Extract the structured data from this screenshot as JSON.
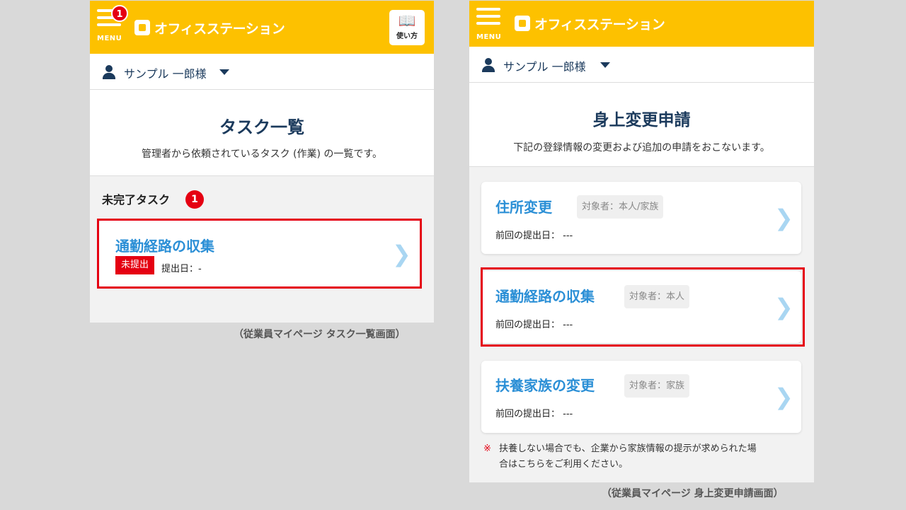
{
  "left": {
    "menu_badge": "1",
    "menu_label": "MENU",
    "logo_text": "オフィスステーション",
    "guide_label": "使い方",
    "user_name": "サンプル 一郎様",
    "title": "タスク一覧",
    "description": "管理者から依頼されているタスク (作業) の一覧です。",
    "section_title": "未完了タスク",
    "section_badge": "1",
    "task": {
      "title": "通勤経路の収集",
      "status": "未提出",
      "submitted": "提出日：-"
    },
    "caption": "（従業員マイページ  タスク一覧画面）"
  },
  "right": {
    "menu_label": "MENU",
    "logo_text": "オフィスステーション",
    "user_name": "サンプル 一郎様",
    "title": "身上変更申請",
    "description": "下記の登録情報の変更および追加の申請をおこないます。",
    "cards": [
      {
        "title": "住所変更",
        "target": "対象者：本人/家族",
        "prev": "前回の提出日： ---"
      },
      {
        "title": "通勤経路の収集",
        "target": "対象者：本人",
        "prev": "前回の提出日： ---"
      },
      {
        "title": "扶養家族の変更",
        "target": "対象者：家族",
        "prev": "前回の提出日： ---"
      }
    ],
    "note_mark": "※",
    "note_line1": "扶養しない場合でも、企業から家族情報の提示が求められた場",
    "note_line2": "合はこちらをご利用ください。",
    "caption": "（従業員マイページ  身上変更申請画面）"
  },
  "colors": {
    "brand": "#fdc100",
    "accent": "#2b8fd6",
    "alert": "#e50012",
    "navy": "#1b3a5c"
  },
  "icons": [
    "hamburger-menu-icon",
    "book-icon",
    "user-icon",
    "caret-down-icon",
    "chevron-right-icon"
  ]
}
